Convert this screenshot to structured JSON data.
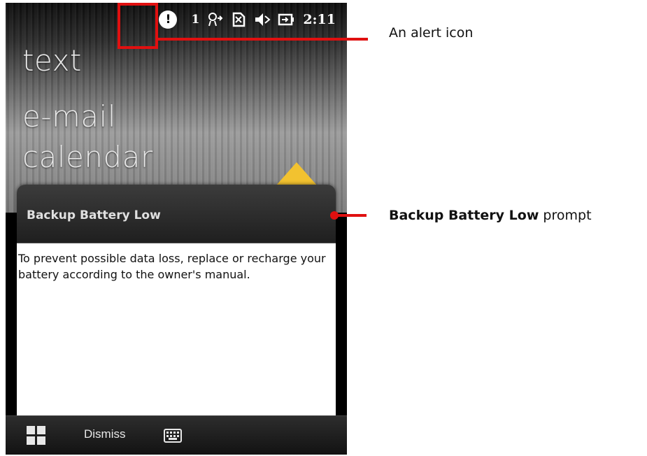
{
  "status_bar": {
    "alert_glyph": "!",
    "notification_count": "1",
    "time": "2:11"
  },
  "home_menu": [
    "text",
    "e-mail",
    "calendar"
  ],
  "notification": {
    "title": "Backup Battery Low",
    "message": "To prevent possible data loss, replace or recharge your battery according to the owner's manual."
  },
  "soft_keys": {
    "center_label": "Dismiss"
  },
  "annotations": {
    "alert": "An alert icon",
    "prompt_bold": "Backup Battery Low",
    "prompt_suffix": " prompt"
  },
  "colors": {
    "annotation_red": "#e01010",
    "star_yellow": "#f2c230"
  },
  "icons": [
    "alert-icon",
    "connectivity-icon",
    "no-sim-icon",
    "speaker-muted-icon",
    "battery-charging-icon",
    "windows-start-icon",
    "keyboard-icon"
  ]
}
